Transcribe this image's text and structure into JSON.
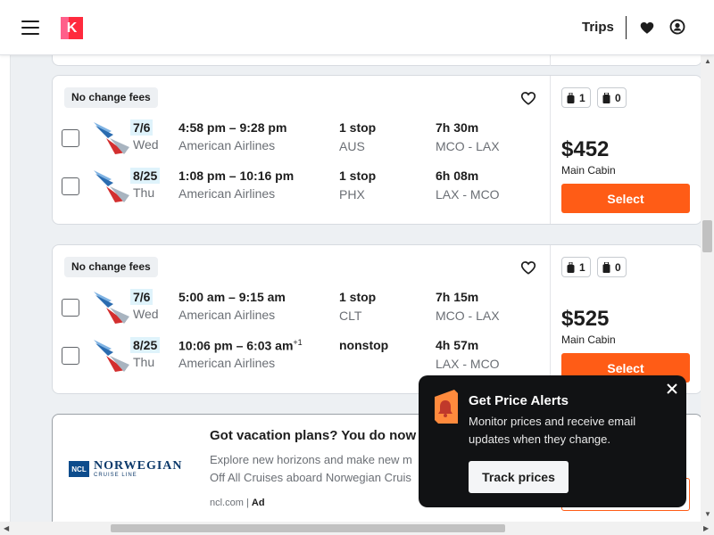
{
  "header": {
    "logo_letter": "K",
    "trips_label": "Trips"
  },
  "cards": [
    {
      "badge": "No change fees",
      "bags": {
        "carry_on": "1",
        "checked": "0"
      },
      "price": "$452",
      "cabin": "Main Cabin",
      "select_label": "Select",
      "legs": [
        {
          "date": "7/6",
          "dow": "Wed",
          "times": "4:58 pm – 9:28 pm",
          "plus_day": "",
          "carrier": "American Airlines",
          "stops": "1 stop",
          "via": "AUS",
          "duration": "7h 30m",
          "route": "MCO - LAX"
        },
        {
          "date": "8/25",
          "dow": "Thu",
          "times": "1:08 pm – 10:16 pm",
          "plus_day": "",
          "carrier": "American Airlines",
          "stops": "1 stop",
          "via": "PHX",
          "duration": "6h 08m",
          "route": "LAX - MCO"
        }
      ]
    },
    {
      "badge": "No change fees",
      "bags": {
        "carry_on": "1",
        "checked": "0"
      },
      "price": "$525",
      "cabin": "Main Cabin",
      "select_label": "Select",
      "legs": [
        {
          "date": "7/6",
          "dow": "Wed",
          "times": "5:00 am – 9:15 am",
          "plus_day": "",
          "carrier": "American Airlines",
          "stops": "1 stop",
          "via": "CLT",
          "duration": "7h 15m",
          "route": "MCO - LAX"
        },
        {
          "date": "8/25",
          "dow": "Thu",
          "times": "10:06 pm – 6:03 am",
          "plus_day": "+1",
          "carrier": "American Airlines",
          "stops": "nonstop",
          "via": "",
          "duration": "4h 57m",
          "route": "LAX - MCO"
        }
      ]
    }
  ],
  "ad": {
    "brand_box": "NCL",
    "brand_name": "NORWEGIAN",
    "brand_sub": "CRUISE LINE",
    "title": "Got vacation plans? You do now",
    "desc_line1": "Explore new horizons and make new m",
    "desc_line2": "Off All Cruises aboard Norwegian Cruis",
    "source": "ncl.com",
    "ad_label": "Ad"
  },
  "popover": {
    "title": "Get Price Alerts",
    "text": "Monitor prices and receive email updates when they change.",
    "button": "Track prices"
  },
  "colors": {
    "accent": "#ff5c16",
    "brand_pink": "#ff2a3d",
    "date_highlight": "#dff3fb",
    "popover_bg": "#111214"
  },
  "icons": [
    "menu-icon",
    "heart-icon",
    "user-icon",
    "carry-on-bag-icon",
    "checked-bag-icon",
    "airline-logo-icon",
    "bell-icon",
    "close-icon"
  ]
}
